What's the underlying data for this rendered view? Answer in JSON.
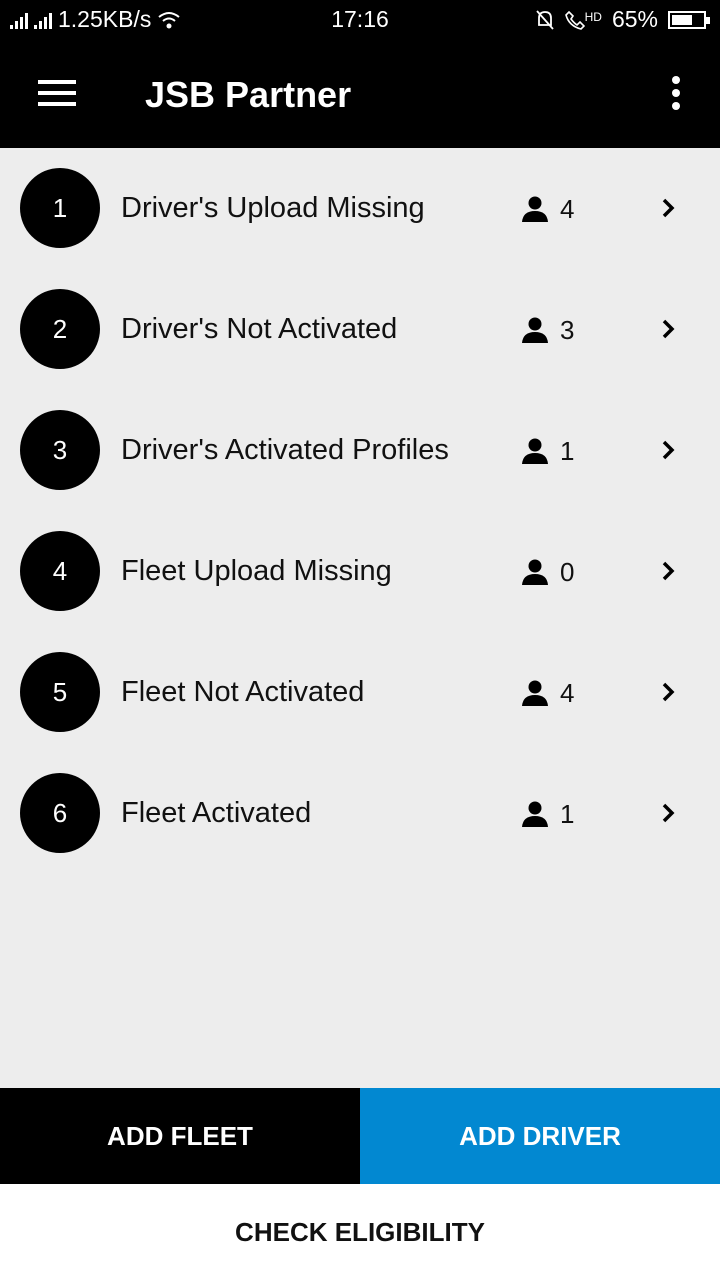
{
  "status_bar": {
    "network_speed": "1.25KB/s",
    "time": "17:16",
    "hd_label": "HD",
    "battery_percent": "65%",
    "battery_level": 0.65
  },
  "app_bar": {
    "title": "JSB Partner",
    "menu_icon": "hamburger-menu-icon",
    "overflow_icon": "more-vertical-icon"
  },
  "items": [
    {
      "number": "1",
      "label": "Driver's Upload Missing",
      "count": "4"
    },
    {
      "number": "2",
      "label": "Driver's Not Activated",
      "count": "3"
    },
    {
      "number": "3",
      "label": "Driver's Activated Profiles",
      "count": "1"
    },
    {
      "number": "4",
      "label": "Fleet Upload Missing",
      "count": "0"
    },
    {
      "number": "5",
      "label": "Fleet Not Activated",
      "count": "4"
    },
    {
      "number": "6",
      "label": "Fleet Activated",
      "count": "1"
    }
  ],
  "buttons": {
    "add_fleet": "ADD FLEET",
    "add_driver": "ADD DRIVER",
    "check_eligibility": "CHECK ELIGIBILITY"
  },
  "colors": {
    "app_bar": "#000000",
    "accent": "#0288d1",
    "background": "#ededed"
  }
}
